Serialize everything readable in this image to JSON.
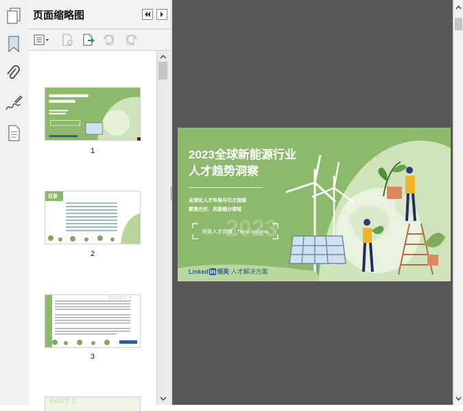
{
  "panel": {
    "title": "页面缩略图"
  },
  "thumbnails": [
    {
      "page": "1"
    },
    {
      "page": "2"
    },
    {
      "page": "3"
    }
  ],
  "cover": {
    "title_line1": "2023全球新能源行业",
    "title_line2": "人才趋势洞察",
    "subtitle_line1": "全球化人才布局与引才指南",
    "subtitle_line2": "聚焦光伏、风能细分领域",
    "box_text": "领英人才洞察 | Think Insights",
    "brand_word": "Linked",
    "brand_in": "in",
    "brand_cn": "领英",
    "brand_tail": "人才解决方案"
  },
  "thumb2_title": "目录",
  "thumb3_title": "PART 1",
  "thumb4_title": "PART 2",
  "colors": {
    "cover_green": "#8db96c",
    "light_green": "#cfe4bb",
    "brand_blue": "#2d5e9c",
    "viewer_gray": "#575757"
  },
  "icons": [
    "pages-icon",
    "bookmark-icon",
    "attachment-icon",
    "signature-icon",
    "document-icon",
    "collapse-panel-icon",
    "expand-panel-icon",
    "options-menu-icon",
    "delete-page-icon",
    "insert-page-icon",
    "rotate-ccw-icon",
    "rotate-cw-icon"
  ]
}
